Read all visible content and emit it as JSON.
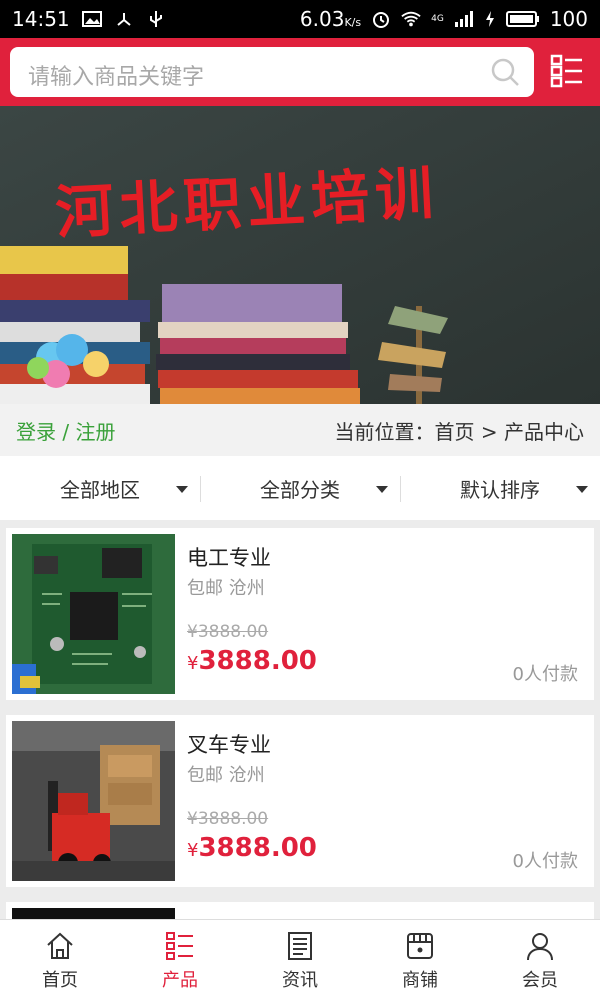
{
  "status": {
    "time": "14:51",
    "speed": "6.03",
    "speed_unit": "K/s",
    "battery": "100",
    "network": "4G"
  },
  "search": {
    "placeholder": "请输入商品关键字"
  },
  "banner": {
    "title": "河北职业培训"
  },
  "location": {
    "login": "登录 / 注册",
    "path": "当前位置：首页 > 产品中心"
  },
  "filters": [
    {
      "label": "全部地区"
    },
    {
      "label": "全部分类"
    },
    {
      "label": "默认排序"
    }
  ],
  "products": [
    {
      "title": "电工专业",
      "sub": "包邮 沧州",
      "old_price": "¥3888.00",
      "currency": "¥",
      "price": "3888.00",
      "paid": "0人付款"
    },
    {
      "title": "叉车专业",
      "sub": "包邮 沧州",
      "old_price": "¥3888.00",
      "currency": "¥",
      "price": "3888.00",
      "paid": "0人付款"
    }
  ],
  "tabs": [
    {
      "label": "首页",
      "icon": "home-icon"
    },
    {
      "label": "产品",
      "icon": "list-icon"
    },
    {
      "label": "资讯",
      "icon": "news-icon"
    },
    {
      "label": "商铺",
      "icon": "shop-icon"
    },
    {
      "label": "会员",
      "icon": "user-icon"
    }
  ],
  "colors": {
    "accent": "#e0213c",
    "login": "#3aa13a"
  }
}
